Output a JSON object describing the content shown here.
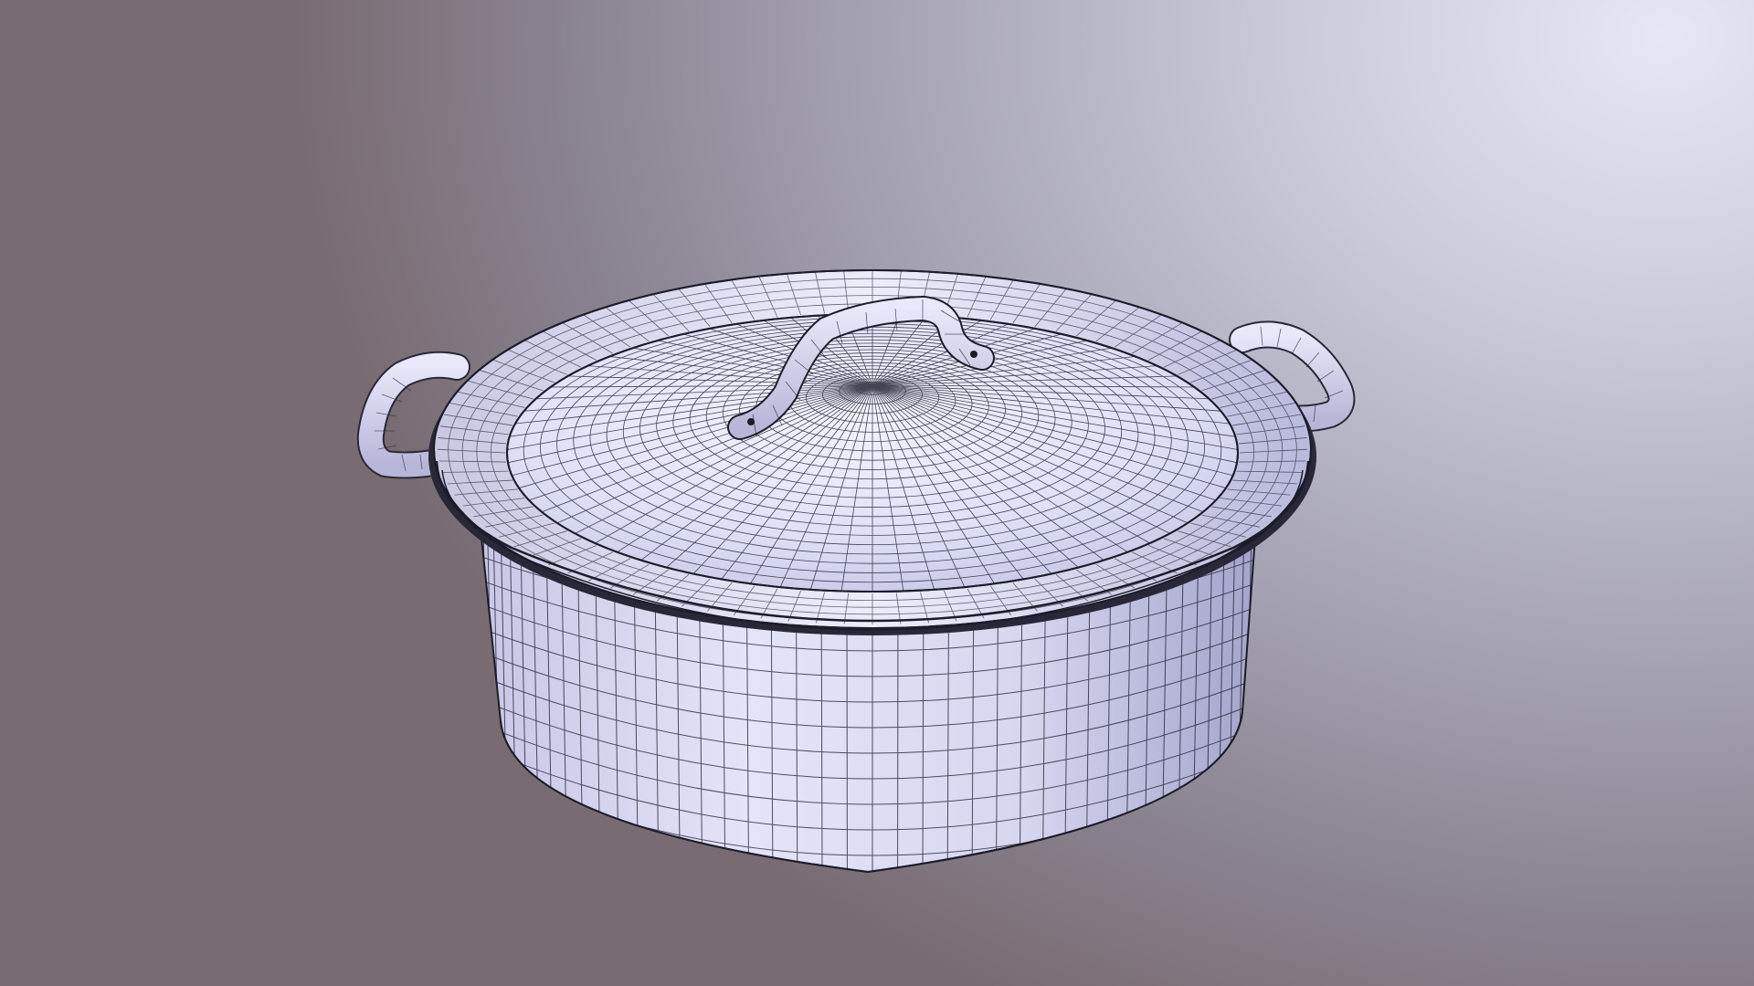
{
  "viewer": {
    "model_label": "",
    "background_top_right": "#e6e7f5",
    "background_bottom_left": "#786c72",
    "mesh_fill": "#dcdcf2",
    "mesh_shade": "#a9a9d2",
    "wireframe_color": "#1c1c2a",
    "highlight_color": "#f2f3ff"
  },
  "model": {
    "object": "cooking-pot-with-lid",
    "display_mode": "wireframe-shaded",
    "parts": [
      "pot-body",
      "pot-rim",
      "lid",
      "lid-handle",
      "left-side-handle",
      "right-side-handle"
    ]
  }
}
